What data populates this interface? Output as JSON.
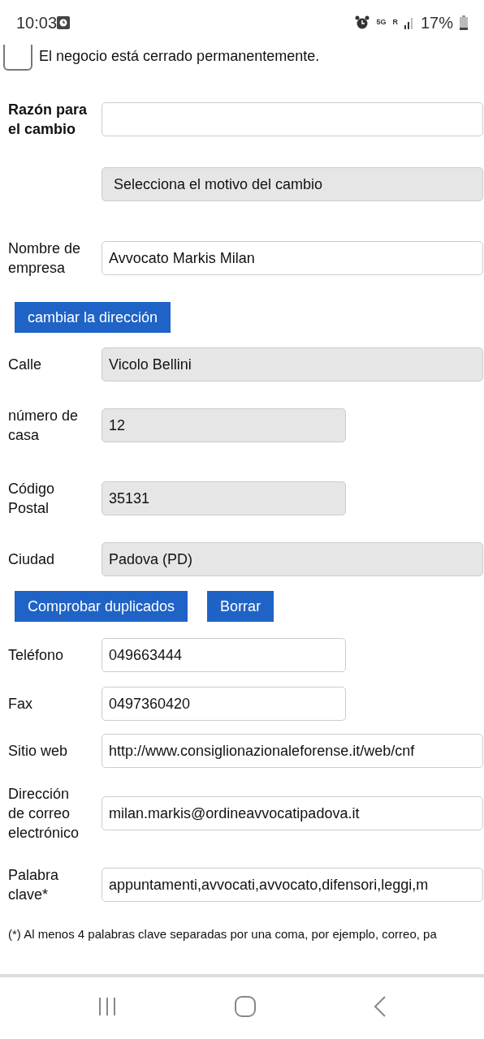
{
  "status_bar": {
    "time": "10:03",
    "network": "5G",
    "roaming": "R",
    "battery": "17%"
  },
  "closed_checkbox": {
    "label": "El negocio está cerrado permanentemente.",
    "checked": false
  },
  "rows": [
    {
      "kind": "input",
      "label": "Razón para el cambio",
      "label_bold": true,
      "value": "",
      "disabled": false,
      "short": false
    },
    {
      "kind": "select",
      "value": "Selecciona el motivo del cambio",
      "disabled": true,
      "short": false
    },
    {
      "kind": "input",
      "label": "Nombre de empresa",
      "label_bold": false,
      "value": "Avvocato Markis Milan",
      "disabled": false,
      "short": false
    },
    {
      "kind": "buttons",
      "buttons": [
        "cambiar la dirección"
      ]
    },
    {
      "kind": "input",
      "label": "Calle",
      "label_bold": false,
      "value": "Vicolo Bellini",
      "disabled": true,
      "short": false
    },
    {
      "kind": "input",
      "label": "número de casa",
      "label_bold": false,
      "value": "12",
      "disabled": true,
      "short": true
    },
    {
      "kind": "input",
      "label": "Código Postal",
      "label_bold": false,
      "value": "35131",
      "disabled": true,
      "short": true
    },
    {
      "kind": "input",
      "label": "Ciudad",
      "label_bold": false,
      "value": "Padova (PD)",
      "disabled": true,
      "short": false
    },
    {
      "kind": "buttons",
      "buttons": [
        "Comprobar duplicados",
        "Borrar"
      ]
    },
    {
      "kind": "input",
      "label": "Teléfono",
      "label_bold": false,
      "value": "049663444",
      "disabled": false,
      "short": true
    },
    {
      "kind": "input",
      "label": "Fax",
      "label_bold": false,
      "value": "0497360420",
      "disabled": false,
      "short": true
    },
    {
      "kind": "input",
      "label": "Sitio web",
      "label_bold": false,
      "value": "http://www.consiglionazionaleforense.it/web/cnf",
      "disabled": false,
      "short": false
    },
    {
      "kind": "input",
      "label": "Dirección de correo electrónico",
      "label_bold": false,
      "value": "milan.markis@ordineavvocatipadova.it",
      "disabled": false,
      "short": false
    },
    {
      "kind": "input",
      "label": "Palabra clave*",
      "label_bold": false,
      "value": "appuntamenti,avvocati,avvocato,difensori,leggi,m",
      "disabled": false,
      "short": false
    }
  ],
  "footnote": "(*) Al menos 4 palabras clave separadas por una coma, por ejemplo, correo, pa"
}
